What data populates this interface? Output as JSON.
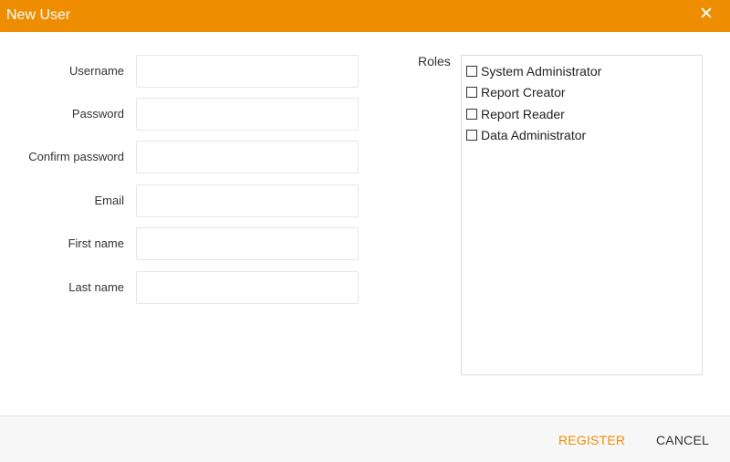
{
  "dialog": {
    "title": "New User",
    "close_glyph": "✕"
  },
  "form": {
    "fields": [
      {
        "label": "Username",
        "value": "",
        "placeholder": ""
      },
      {
        "label": "Password",
        "value": "",
        "placeholder": ""
      },
      {
        "label": "Confirm password",
        "value": "",
        "placeholder": ""
      },
      {
        "label": "Email",
        "value": "",
        "placeholder": ""
      },
      {
        "label": "First name",
        "value": "",
        "placeholder": ""
      },
      {
        "label": "Last name",
        "value": "",
        "placeholder": ""
      }
    ]
  },
  "roles": {
    "label": "Roles",
    "items": [
      {
        "label": "System Administrator",
        "checked": false
      },
      {
        "label": "Report Creator",
        "checked": false
      },
      {
        "label": "Report Reader",
        "checked": false
      },
      {
        "label": "Data Administrator",
        "checked": false
      }
    ]
  },
  "footer": {
    "register_label": "REGISTER",
    "cancel_label": "CANCEL"
  },
  "colors": {
    "accent": "#ee8d00",
    "title_text": "#ffffff",
    "footer_bg": "#f7f7f7"
  },
  "icons": {
    "close": "close-icon",
    "checkbox": "checkbox-unchecked"
  }
}
